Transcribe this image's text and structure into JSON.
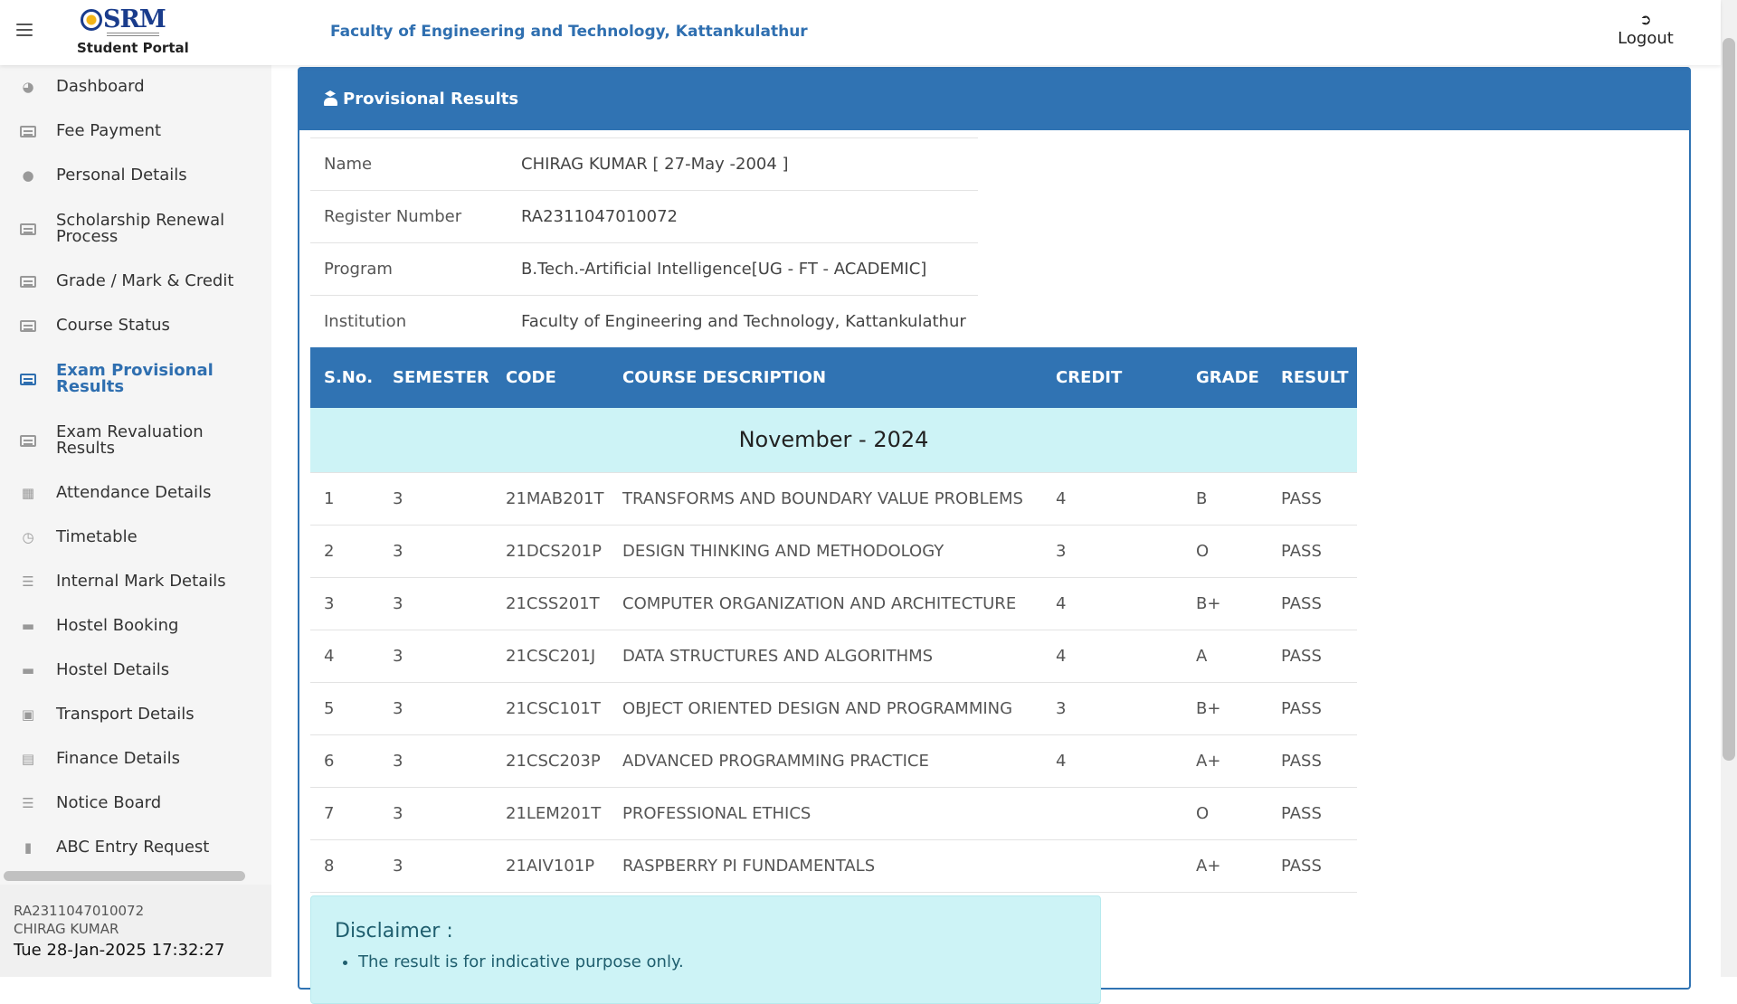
{
  "header": {
    "portal_title": "Student Portal",
    "logo_text": "SRM",
    "faculty": "Faculty of Engineering and Technology, Kattankulathur",
    "logout_label": "Logout",
    "logout_icon": "sign-out-icon",
    "menu_icon": "hamburger-icon"
  },
  "sidebar": {
    "items": [
      {
        "label": "Dashboard",
        "icon": "dashboard-icon"
      },
      {
        "label": "Fee Payment",
        "icon": "card-icon"
      },
      {
        "label": "Personal Details",
        "icon": "user-icon"
      },
      {
        "label": "Scholarship Renewal Process",
        "icon": "card-icon"
      },
      {
        "label": "Grade / Mark & Credit",
        "icon": "card-icon"
      },
      {
        "label": "Course Status",
        "icon": "card-icon"
      },
      {
        "label": "Exam Provisional Results",
        "icon": "card-icon",
        "active": true
      },
      {
        "label": "Exam Revaluation Results",
        "icon": "card-icon"
      },
      {
        "label": "Attendance Details",
        "icon": "calculator-icon"
      },
      {
        "label": "Timetable",
        "icon": "clock-icon"
      },
      {
        "label": "Internal Mark Details",
        "icon": "list-icon"
      },
      {
        "label": "Hostel Booking",
        "icon": "bed-icon"
      },
      {
        "label": "Hostel Details",
        "icon": "bed-icon"
      },
      {
        "label": "Transport Details",
        "icon": "bus-icon"
      },
      {
        "label": "Finance Details",
        "icon": "receipt-icon"
      },
      {
        "label": "Notice Board",
        "icon": "list-icon"
      },
      {
        "label": "ABC Entry Request",
        "icon": "book-icon"
      }
    ],
    "user": {
      "register_number": "RA2311047010072",
      "name": "CHIRAG KUMAR",
      "datetime": "Tue 28-Jan-2025 17:32:27"
    }
  },
  "panel": {
    "title": "Provisional Results",
    "title_icon": "graduate-icon",
    "info": [
      {
        "key": "Name",
        "value": "CHIRAG KUMAR [ 27-May -2004 ]"
      },
      {
        "key": "Register Number",
        "value": "RA2311047010072"
      },
      {
        "key": "Program",
        "value": "B.Tech.-Artificial Intelligence[UG - FT - ACADEMIC]"
      },
      {
        "key": "Institution",
        "value": "Faculty of Engineering and Technology, Kattankulathur"
      }
    ],
    "columns": [
      "S.No.",
      "SEMESTER",
      "CODE",
      "COURSE DESCRIPTION",
      "CREDIT",
      "GRADE",
      "RESULT"
    ],
    "session": "November - 2024",
    "rows": [
      {
        "sno": "1",
        "sem": "3",
        "code": "21MAB201T",
        "desc": "TRANSFORMS AND BOUNDARY VALUE PROBLEMS",
        "credit": "4",
        "grade": "B",
        "result": "PASS"
      },
      {
        "sno": "2",
        "sem": "3",
        "code": "21DCS201P",
        "desc": "DESIGN THINKING AND METHODOLOGY",
        "credit": "3",
        "grade": "O",
        "result": "PASS"
      },
      {
        "sno": "3",
        "sem": "3",
        "code": "21CSS201T",
        "desc": "COMPUTER ORGANIZATION AND ARCHITECTURE",
        "credit": "4",
        "grade": "B+",
        "result": "PASS"
      },
      {
        "sno": "4",
        "sem": "3",
        "code": "21CSC201J",
        "desc": "DATA STRUCTURES AND ALGORITHMS",
        "credit": "4",
        "grade": "A",
        "result": "PASS"
      },
      {
        "sno": "5",
        "sem": "3",
        "code": "21CSC101T",
        "desc": "OBJECT ORIENTED DESIGN AND PROGRAMMING",
        "credit": "3",
        "grade": "B+",
        "result": "PASS"
      },
      {
        "sno": "6",
        "sem": "3",
        "code": "21CSC203P",
        "desc": "ADVANCED PROGRAMMING PRACTICE",
        "credit": "4",
        "grade": "A+",
        "result": "PASS"
      },
      {
        "sno": "7",
        "sem": "3",
        "code": "21LEM201T",
        "desc": "PROFESSIONAL ETHICS",
        "credit": "",
        "grade": "O",
        "result": "PASS"
      },
      {
        "sno": "8",
        "sem": "3",
        "code": "21AIV101P",
        "desc": "RASPBERRY PI FUNDAMENTALS",
        "credit": "",
        "grade": "A+",
        "result": "PASS"
      }
    ],
    "disclaimer": {
      "title": "Disclaimer :",
      "items": [
        "The result is for indicative purpose only."
      ]
    }
  },
  "colors": {
    "primary": "#3073b3",
    "session_bg": "#cdf3f6",
    "sidebar_bg": "#f5f5f5"
  }
}
